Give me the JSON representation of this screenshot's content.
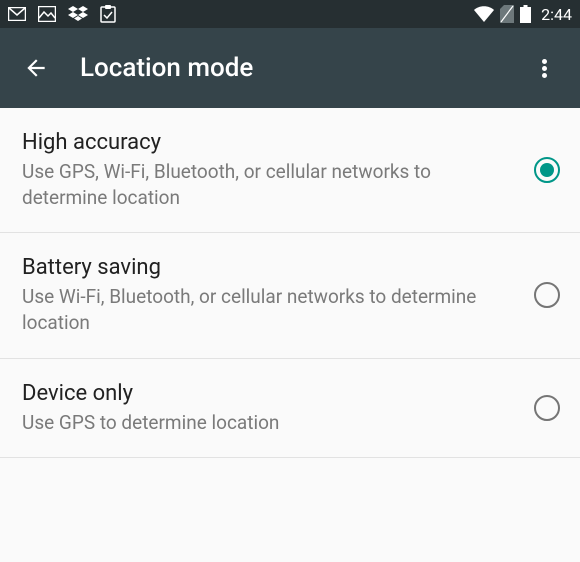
{
  "status": {
    "time": "2:44"
  },
  "appbar": {
    "title": "Location mode"
  },
  "options": [
    {
      "title": "High accuracy",
      "desc": "Use GPS, Wi-Fi, Bluetooth, or cellular networks to determine location",
      "selected": true
    },
    {
      "title": "Battery saving",
      "desc": "Use Wi-Fi, Bluetooth, or cellular networks to determine location",
      "selected": false
    },
    {
      "title": "Device only",
      "desc": "Use GPS to determine location",
      "selected": false
    }
  ]
}
